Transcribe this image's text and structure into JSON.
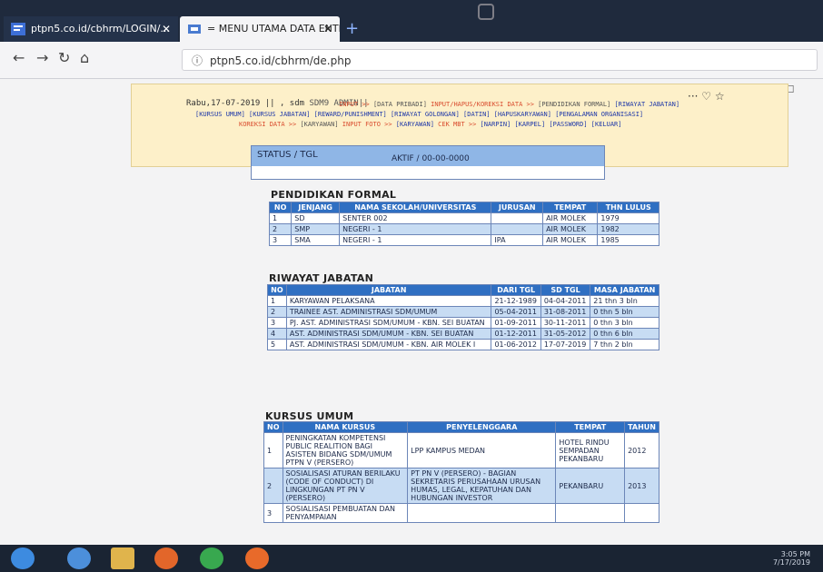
{
  "browser": {
    "tabs": [
      {
        "label": "ptpn5.co.id/cbhrm/LOGIN/..."
      },
      {
        "label": "= MENU UTAMA DATA ENTRY"
      }
    ],
    "url": "ptpn5.co.id/cbhrm/de.php",
    "url_info_symbol": "ⓘ"
  },
  "header": {
    "date_line": "Rabu,17-07-2019 || , sdm",
    "user": "SDM9 ADMIN||",
    "menu_row1": [
      {
        "text": "INPUT >>",
        "color": "red"
      },
      {
        "text": "[DATA PRIBADI]",
        "color": "grey"
      },
      {
        "text": "INPUT/HAPUS/KOREKSI DATA >>",
        "color": "red"
      },
      {
        "text": "[PENDIDIKAN FORMAL]",
        "color": "grey"
      },
      {
        "text": "[RIWAYAT JABATAN]",
        "color": "blue"
      }
    ],
    "menu_row2": [
      {
        "text": "[KURSUS UMUM]",
        "color": "blue"
      },
      {
        "text": "[KURSUS JABATAN]",
        "color": "blue"
      },
      {
        "text": "[REWARD/PUNISHMENT]",
        "color": "blue"
      },
      {
        "text": "[RIWAYAT GOLONGAN]",
        "color": "blue"
      },
      {
        "text": "[DATIN]",
        "color": "blue"
      },
      {
        "text": "[HAPUSKARYAWAN]",
        "color": "blue"
      },
      {
        "text": "[PENGALAMAN ORGANISASI]",
        "color": "blue"
      }
    ],
    "menu_row3": [
      {
        "text": "KOREKSI DATA >>",
        "color": "red"
      },
      {
        "text": "[KARYAWAN]",
        "color": "grey"
      },
      {
        "text": "INPUT FOTO >>",
        "color": "red"
      },
      {
        "text": "[KARYAWAN]",
        "color": "blue"
      },
      {
        "text": "CEK MBT >>",
        "color": "red"
      },
      {
        "text": "[NARPIN]",
        "color": "blue"
      },
      {
        "text": "[KARPEL]",
        "color": "blue"
      },
      {
        "text": "[PASSWORD]",
        "color": "blue"
      },
      {
        "text": "[KELUAR]",
        "color": "blue"
      }
    ],
    "icons_text": "··· ♡ ☆"
  },
  "status": {
    "label": "STATUS / TGL",
    "value": "AKTIF / 00-00-0000"
  },
  "pendidikan": {
    "title": "PENDIDIKAN FORMAL",
    "headers": [
      "NO",
      "JENJANG",
      "NAMA SEKOLAH/UNIVERSITAS",
      "JURUSAN",
      "TEMPAT",
      "THN LULUS"
    ],
    "rows": [
      [
        "1",
        "SD",
        "SENTER 002",
        "",
        "AIR MOLEK",
        "1979"
      ],
      [
        "2",
        "SMP",
        "NEGERI - 1",
        "",
        "AIR MOLEK",
        "1982"
      ],
      [
        "3",
        "SMA",
        "NEGERI - 1",
        "IPA",
        "AIR MOLEK",
        "1985"
      ]
    ]
  },
  "jabatan": {
    "title": "RIWAYAT JABATAN",
    "headers": [
      "NO",
      "JABATAN",
      "DARI TGL",
      "SD TGL",
      "MASA JABATAN"
    ],
    "rows": [
      [
        "1",
        "KARYAWAN PELAKSANA",
        "21-12-1989",
        "04-04-2011",
        "21 thn 3 bln"
      ],
      [
        "2",
        "TRAINEE AST. ADMINISTRASI SDM/UMUM",
        "05-04-2011",
        "31-08-2011",
        "0 thn 5 bln"
      ],
      [
        "3",
        "PJ. AST. ADMINISTRASI SDM/UMUM - KBN. SEI BUATAN",
        "01-09-2011",
        "30-11-2011",
        "0 thn 3 bln"
      ],
      [
        "4",
        "AST. ADMINISTRASI SDM/UMUM - KBN. SEI BUATAN",
        "01-12-2011",
        "31-05-2012",
        "0 thn 6 bln"
      ],
      [
        "5",
        "AST. ADMINISTRASI SDM/UMUM - KBN. AIR MOLEK I",
        "01-06-2012",
        "17-07-2019",
        "7 thn 2 bln"
      ]
    ]
  },
  "kursus": {
    "title": "KURSUS UMUM",
    "headers": [
      "NO",
      "NAMA KURSUS",
      "PENYELENGGARA",
      "TEMPAT",
      "TAHUN"
    ],
    "rows": [
      [
        "1",
        "PENINGKATAN KOMPETENSI PUBLIC REALITION BAGI ASISTEN BIDANG SDM/UMUM PTPN V (PERSERO)",
        "LPP KAMPUS MEDAN",
        "HOTEL RINDU SEMPADAN PEKANBARU",
        "2012"
      ],
      [
        "2",
        "SOSIALISASI ATURAN BERILAKU (CODE OF CONDUCT) DI LINGKUNGAN PT PN V (PERSERO)",
        "PT PN V (PERSERO) - BAGIAN SEKRETARIS PERUSAHAAN URUSAN HUMAS, LEGAL, KEPATUHAN DAN HUBUNGAN INVESTOR",
        "PEKANBARU",
        "2013"
      ],
      [
        "3",
        "SOSIALISASI PEMBUATAN DAN PENYAMPAIAN",
        "",
        "",
        ""
      ]
    ]
  },
  "taskbar": {
    "tray_time": "3:05 PM",
    "tray_date": "7/17/2019"
  }
}
